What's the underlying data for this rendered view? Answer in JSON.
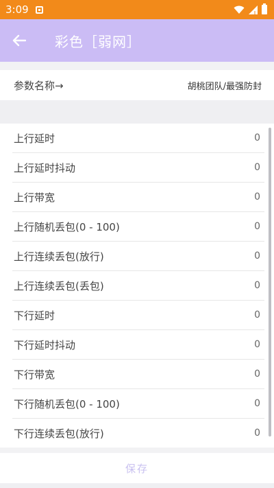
{
  "status_bar": {
    "time": "3:09"
  },
  "app_bar": {
    "title": "彩色［弱网］"
  },
  "param": {
    "label": "参数名称→",
    "value": "胡桃团队/最强防封"
  },
  "settings": [
    {
      "label": "上行延时",
      "value": "0"
    },
    {
      "label": "上行延时抖动",
      "value": "0"
    },
    {
      "label": "上行带宽",
      "value": "0"
    },
    {
      "label": "上行随机丢包(0 - 100)",
      "value": "0"
    },
    {
      "label": "上行连续丢包(放行)",
      "value": "0"
    },
    {
      "label": "上行连续丢包(丢包)",
      "value": "0"
    },
    {
      "label": "下行延时",
      "value": "0"
    },
    {
      "label": "下行延时抖动",
      "value": "0"
    },
    {
      "label": "下行带宽",
      "value": "0"
    },
    {
      "label": "下行随机丢包(0 - 100)",
      "value": "0"
    },
    {
      "label": "下行连续丢包(放行)",
      "value": "0"
    }
  ],
  "footer": {
    "save_label": "保存"
  },
  "colors": {
    "status_bar": "#f28a1a",
    "app_bar": "#cbbcf5",
    "save_text": "#c9c1f0"
  },
  "icons": {
    "back": "arrow-left-icon",
    "wifi": "wifi-icon",
    "signal": "signal-icon",
    "battery": "battery-icon",
    "notification": "notification-icon"
  }
}
